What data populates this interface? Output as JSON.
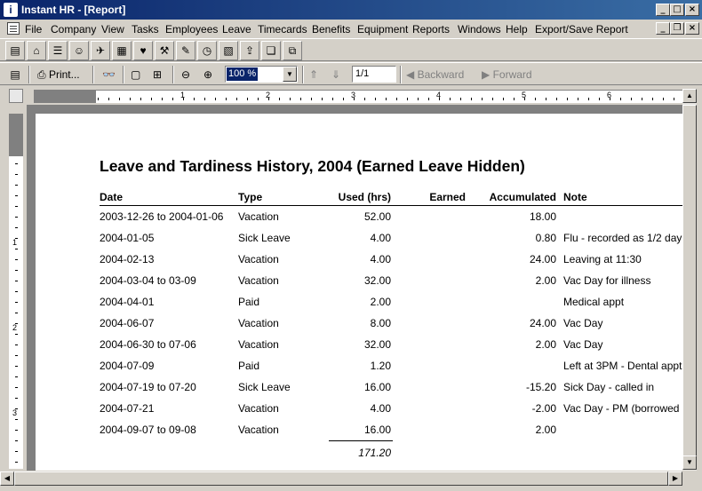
{
  "window": {
    "title": "Instant HR - [Report]"
  },
  "menu": [
    "File",
    "Company",
    "View",
    "Tasks",
    "Employees",
    "Leave",
    "Timecards",
    "Benefits",
    "Equipment",
    "Reports",
    "Windows",
    "Help",
    "Export/Save Report"
  ],
  "toolbar2": {
    "print_label": "Print...",
    "zoom_value": "100 %",
    "page_value": "1/1",
    "backward_label": "Backward",
    "forward_label": "Forward"
  },
  "ruler": {
    "h_labels": [
      "1",
      "2",
      "3",
      "4",
      "5",
      "6"
    ],
    "v_labels": [
      "1",
      "2",
      "3"
    ]
  },
  "report": {
    "title": "Leave and Tardiness History, 2004 (Earned Leave Hidden)",
    "headers": {
      "date": "Date",
      "type": "Type",
      "used": "Used (hrs)",
      "earned": "Earned",
      "accumulated": "Accumulated",
      "note": "Note"
    },
    "rows": [
      {
        "date": "2003-12-26 to 2004-01-06",
        "type": "Vacation",
        "used": "52.00",
        "earned": "",
        "accumulated": "18.00",
        "note": ""
      },
      {
        "date": "2004-01-05",
        "type": "Sick Leave",
        "used": "4.00",
        "earned": "",
        "accumulated": "0.80",
        "note": "Flu - recorded as 1/2 day"
      },
      {
        "date": "2004-02-13",
        "type": "Vacation",
        "used": "4.00",
        "earned": "",
        "accumulated": "24.00",
        "note": "Leaving at 11:30"
      },
      {
        "date": "2004-03-04 to 03-09",
        "type": "Vacation",
        "used": "32.00",
        "earned": "",
        "accumulated": "2.00",
        "note": "Vac Day for illness"
      },
      {
        "date": "2004-04-01",
        "type": "Paid",
        "used": "2.00",
        "earned": "",
        "accumulated": "",
        "note": "Medical appt"
      },
      {
        "date": "2004-06-07",
        "type": "Vacation",
        "used": "8.00",
        "earned": "",
        "accumulated": "24.00",
        "note": "Vac Day"
      },
      {
        "date": "2004-06-30 to 07-06",
        "type": "Vacation",
        "used": "32.00",
        "earned": "",
        "accumulated": "2.00",
        "note": "Vac Day"
      },
      {
        "date": "2004-07-09",
        "type": "Paid",
        "used": "1.20",
        "earned": "",
        "accumulated": "",
        "note": "Left at 3PM - Dental appt"
      },
      {
        "date": "2004-07-19 to 07-20",
        "type": "Sick Leave",
        "used": "16.00",
        "earned": "",
        "accumulated": "-15.20",
        "note": "Sick Day - called in"
      },
      {
        "date": "2004-07-21",
        "type": "Vacation",
        "used": "4.00",
        "earned": "",
        "accumulated": "-2.00",
        "note": "Vac Day - PM (borrowed"
      },
      {
        "date": "2004-09-07 to 09-08",
        "type": "Vacation",
        "used": "16.00",
        "earned": "",
        "accumulated": "2.00",
        "note": ""
      }
    ],
    "total_used": "171.20"
  },
  "icons": [
    "document-icon",
    "company-icon",
    "tasks-icon",
    "employees-icon",
    "leave-icon",
    "timecards-icon",
    "benefits-icon",
    "clock-icon",
    "reports-icon",
    "export-icon",
    "open-folder-icon",
    "window-icon"
  ],
  "colors": {
    "title_gradient_start": "#0a246a",
    "title_gradient_end": "#3a6ea5",
    "chrome": "#d4d0c8",
    "canvas": "#808080"
  }
}
